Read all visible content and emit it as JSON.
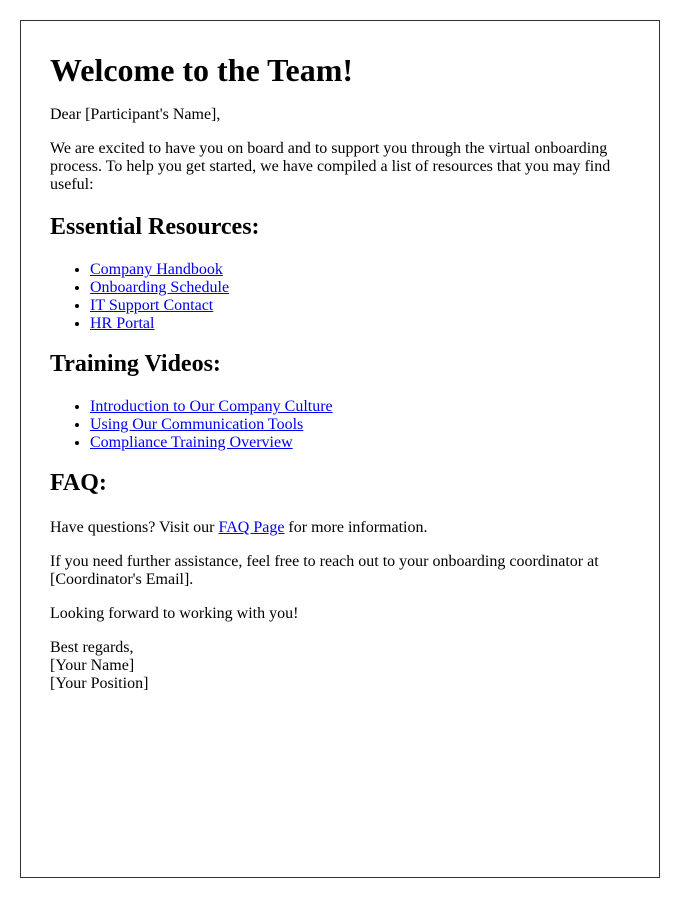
{
  "title": "Welcome to the Team!",
  "greeting": "Dear [Participant's Name],",
  "intro": "We are excited to have you on board and to support you through the virtual onboarding process. To help you get started, we have compiled a list of resources that you may find useful:",
  "sections": {
    "resources": {
      "heading": "Essential Resources:",
      "links": [
        {
          "label": "Company Handbook"
        },
        {
          "label": "Onboarding Schedule"
        },
        {
          "label": "IT Support Contact"
        },
        {
          "label": "HR Portal"
        }
      ]
    },
    "videos": {
      "heading": "Training Videos:",
      "links": [
        {
          "label": "Introduction to Our Company Culture"
        },
        {
          "label": "Using Our Communication Tools"
        },
        {
          "label": "Compliance Training Overview"
        }
      ]
    },
    "faq": {
      "heading": "FAQ:",
      "text_before": "Have questions? Visit our ",
      "link_label": "FAQ Page",
      "text_after": " for more information."
    }
  },
  "assistance": "If you need further assistance, feel free to reach out to your onboarding coordinator at [Coordinator's Email].",
  "closing": "Looking forward to working with you!",
  "signoff": {
    "regards": "Best regards,",
    "name": "[Your Name]",
    "position": "[Your Position]"
  },
  "colors": {
    "link": "#0000ee",
    "border": "#333333",
    "text": "#000000"
  }
}
